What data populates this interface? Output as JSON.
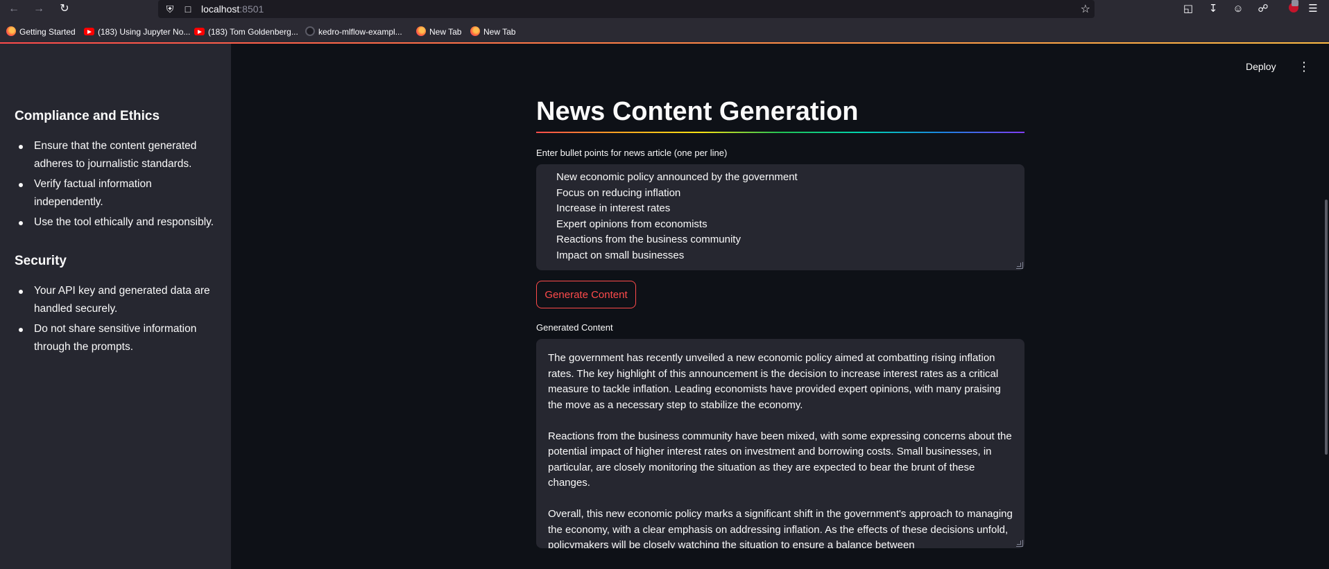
{
  "browser": {
    "url_host": "localhost",
    "url_port": ":8501",
    "bookmarks": [
      {
        "label": "Getting Started",
        "icon": "firefox-icon"
      },
      {
        "label": "(183) Using Jupyter No...",
        "icon": "youtube-icon"
      },
      {
        "label": "(183) Tom Goldenberg...",
        "icon": "youtube-icon"
      },
      {
        "label": "kedro-mlflow-exampl...",
        "icon": "github-icon"
      },
      {
        "label": "New Tab",
        "icon": "firefox-icon"
      },
      {
        "label": "New Tab",
        "icon": "firefox-icon"
      }
    ]
  },
  "header": {
    "deploy_label": "Deploy"
  },
  "sidebar": {
    "compliance_title": "Compliance and Ethics",
    "compliance_items": [
      "Ensure that the content generated adheres to journalistic standards.",
      "Verify factual information independently.",
      "Use the tool ethically and responsibly."
    ],
    "security_title": "Security",
    "security_items": [
      "Your API key and generated data are handled securely.",
      "Do not share sensitive information through the prompts."
    ]
  },
  "main": {
    "title": "News Content Generation",
    "input_label": "Enter bullet points for news article (one per line)",
    "input_lines": [
      "New economic policy announced by the government",
      "Focus on reducing inflation",
      "Increase in interest rates",
      "Expert opinions from economists",
      "Reactions from the business community",
      "Impact on small businesses"
    ],
    "generate_button": "Generate Content",
    "output_label": "Generated Content",
    "output_paragraphs": [
      "The government has recently unveiled a new economic policy aimed at combatting rising inflation rates. The key highlight of this announcement is the decision to increase interest rates as a critical measure to tackle inflation. Leading economists have provided expert opinions, with many praising the move as a necessary step to stabilize the economy.",
      "Reactions from the business community have been mixed, with some expressing concerns about the potential impact of higher interest rates on investment and borrowing costs. Small businesses, in particular, are closely monitoring the situation as they are expected to bear the brunt of these changes.",
      "Overall, this new economic policy marks a significant shift in the government's approach to managing the economy, with a clear emphasis on addressing inflation. As the effects of these decisions unfold, policymakers will be closely watching the situation to ensure a balance between"
    ]
  },
  "colors": {
    "accent": "#ff4b4b",
    "background": "#0e1117",
    "sidebar": "#262730"
  }
}
